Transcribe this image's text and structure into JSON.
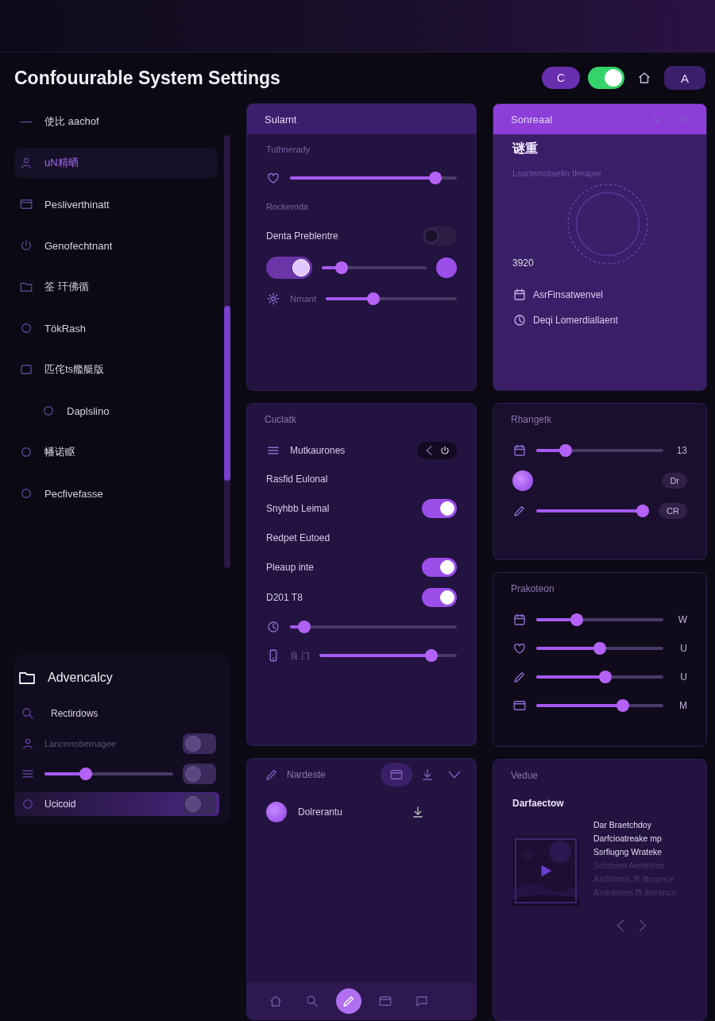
{
  "window": {
    "title": "Confouurable System Settings"
  },
  "header": {
    "chip": "C",
    "switch_on": true,
    "avatar": "A"
  },
  "sidebar": {
    "items": [
      {
        "label": "使比 aachof",
        "selected": false
      },
      {
        "label": "uN精晒",
        "selected": true
      },
      {
        "label": "Pesliverthinatt",
        "selected": false
      },
      {
        "label": "Genofechtnant",
        "selected": false
      },
      {
        "label": "筌 玕佛循",
        "selected": false
      },
      {
        "label": "TökRash",
        "selected": false
      },
      {
        "label": "匹侘ts艦艇版",
        "selected": false,
        "children": [
          {
            "label": "Daplslino",
            "selected": false
          }
        ]
      },
      {
        "label": "幡诺眍",
        "selected": false
      },
      {
        "label": "Pecfivefasse",
        "selected": false
      }
    ]
  },
  "advanced": {
    "title": "Advencalcy",
    "rows": [
      {
        "kind": "field",
        "value": "Rectirdows",
        "selected": false
      },
      {
        "kind": "toggle",
        "label": "Lancerrobernagee",
        "on": false,
        "selected": false
      },
      {
        "kind": "slider",
        "level": 0.3,
        "on": false,
        "selected": false
      },
      {
        "kind": "toggle",
        "label": "Ucicoid",
        "on": false,
        "selected": true
      }
    ]
  },
  "settings_panel": {
    "title": "Sulamt",
    "rows": [
      {
        "kind": "caption",
        "label": "Tuthnerady"
      },
      {
        "kind": "slider",
        "level": 0.9
      },
      {
        "kind": "caption",
        "label": "Rockeroda"
      },
      {
        "kind": "toggle",
        "label": "Denta Preblentre",
        "on": false
      },
      {
        "kind": "switch_slider",
        "on": true,
        "level": 0.15
      },
      {
        "kind": "slider",
        "label": "Nrnant",
        "level": 0.35
      }
    ]
  },
  "status_panel": {
    "title": "Sonreaal",
    "heading": "谜重",
    "subtitle": "Lsartemotaelin tlreaper",
    "reading": "3920",
    "links": [
      "AsrFinsatwenvel",
      "Deqi Lomerdiallaent"
    ]
  },
  "control_panel": {
    "title": "Cuclatk",
    "rows": [
      {
        "kind": "picker",
        "label": "Mutkaurones",
        "options": [
          {
            "selected": false
          },
          {
            "selected": true
          }
        ]
      },
      {
        "kind": "text",
        "label": "Rasfid Eulonal"
      },
      {
        "kind": "toggle",
        "label": "Snyhbb Leimal",
        "on": true
      },
      {
        "kind": "text",
        "label": "Redpet Eutoed"
      },
      {
        "kind": "toggle",
        "label": "Pleaup inte",
        "on": true
      },
      {
        "kind": "toggle",
        "label": "D201 T8",
        "on": true
      },
      {
        "kind": "slider",
        "level": 0.05
      },
      {
        "kind": "slider",
        "label": "良 门",
        "level": 0.85
      }
    ]
  },
  "range_panel": {
    "title": "Rhangetk",
    "rows": [
      {
        "kind": "slider",
        "level": 0.2,
        "value": "13"
      },
      {
        "kind": "badge",
        "badge": "Dr"
      },
      {
        "kind": "slider",
        "level": 1,
        "badge": "CR"
      }
    ]
  },
  "protection_panel": {
    "title": "Prakoteon",
    "rows": [
      {
        "kind": "slider",
        "level": 0.3,
        "value": "W"
      },
      {
        "kind": "slider",
        "level": 0.5,
        "value": "U"
      },
      {
        "kind": "slider",
        "level": 0.55,
        "value": "U"
      },
      {
        "kind": "slider",
        "level": 0.7,
        "value": "M"
      }
    ]
  },
  "list_panel": {
    "title": "Nardeste",
    "entries": [
      {
        "label": "Dolrerantu"
      }
    ],
    "nav": [
      {
        "selected": false
      },
      {
        "selected": false
      },
      {
        "selected": true
      },
      {
        "selected": false
      },
      {
        "selected": false
      }
    ]
  },
  "video_panel": {
    "title": "Vedue",
    "subtitle": "Darfaectow",
    "lines": [
      {
        "text": "Dar Braetchdoy",
        "muted": false
      },
      {
        "text": "Darfcioatreake mp",
        "muted": false
      },
      {
        "text": "Ssrfiugng Wrateke",
        "muted": false
      },
      {
        "text": "Schrbeet Aerfettion",
        "muted": true
      },
      {
        "text": "Asdrdortis ffl ittorance",
        "muted": true
      },
      {
        "text": "Asdrdoreis ffl ittorance",
        "muted": true
      }
    ]
  }
}
